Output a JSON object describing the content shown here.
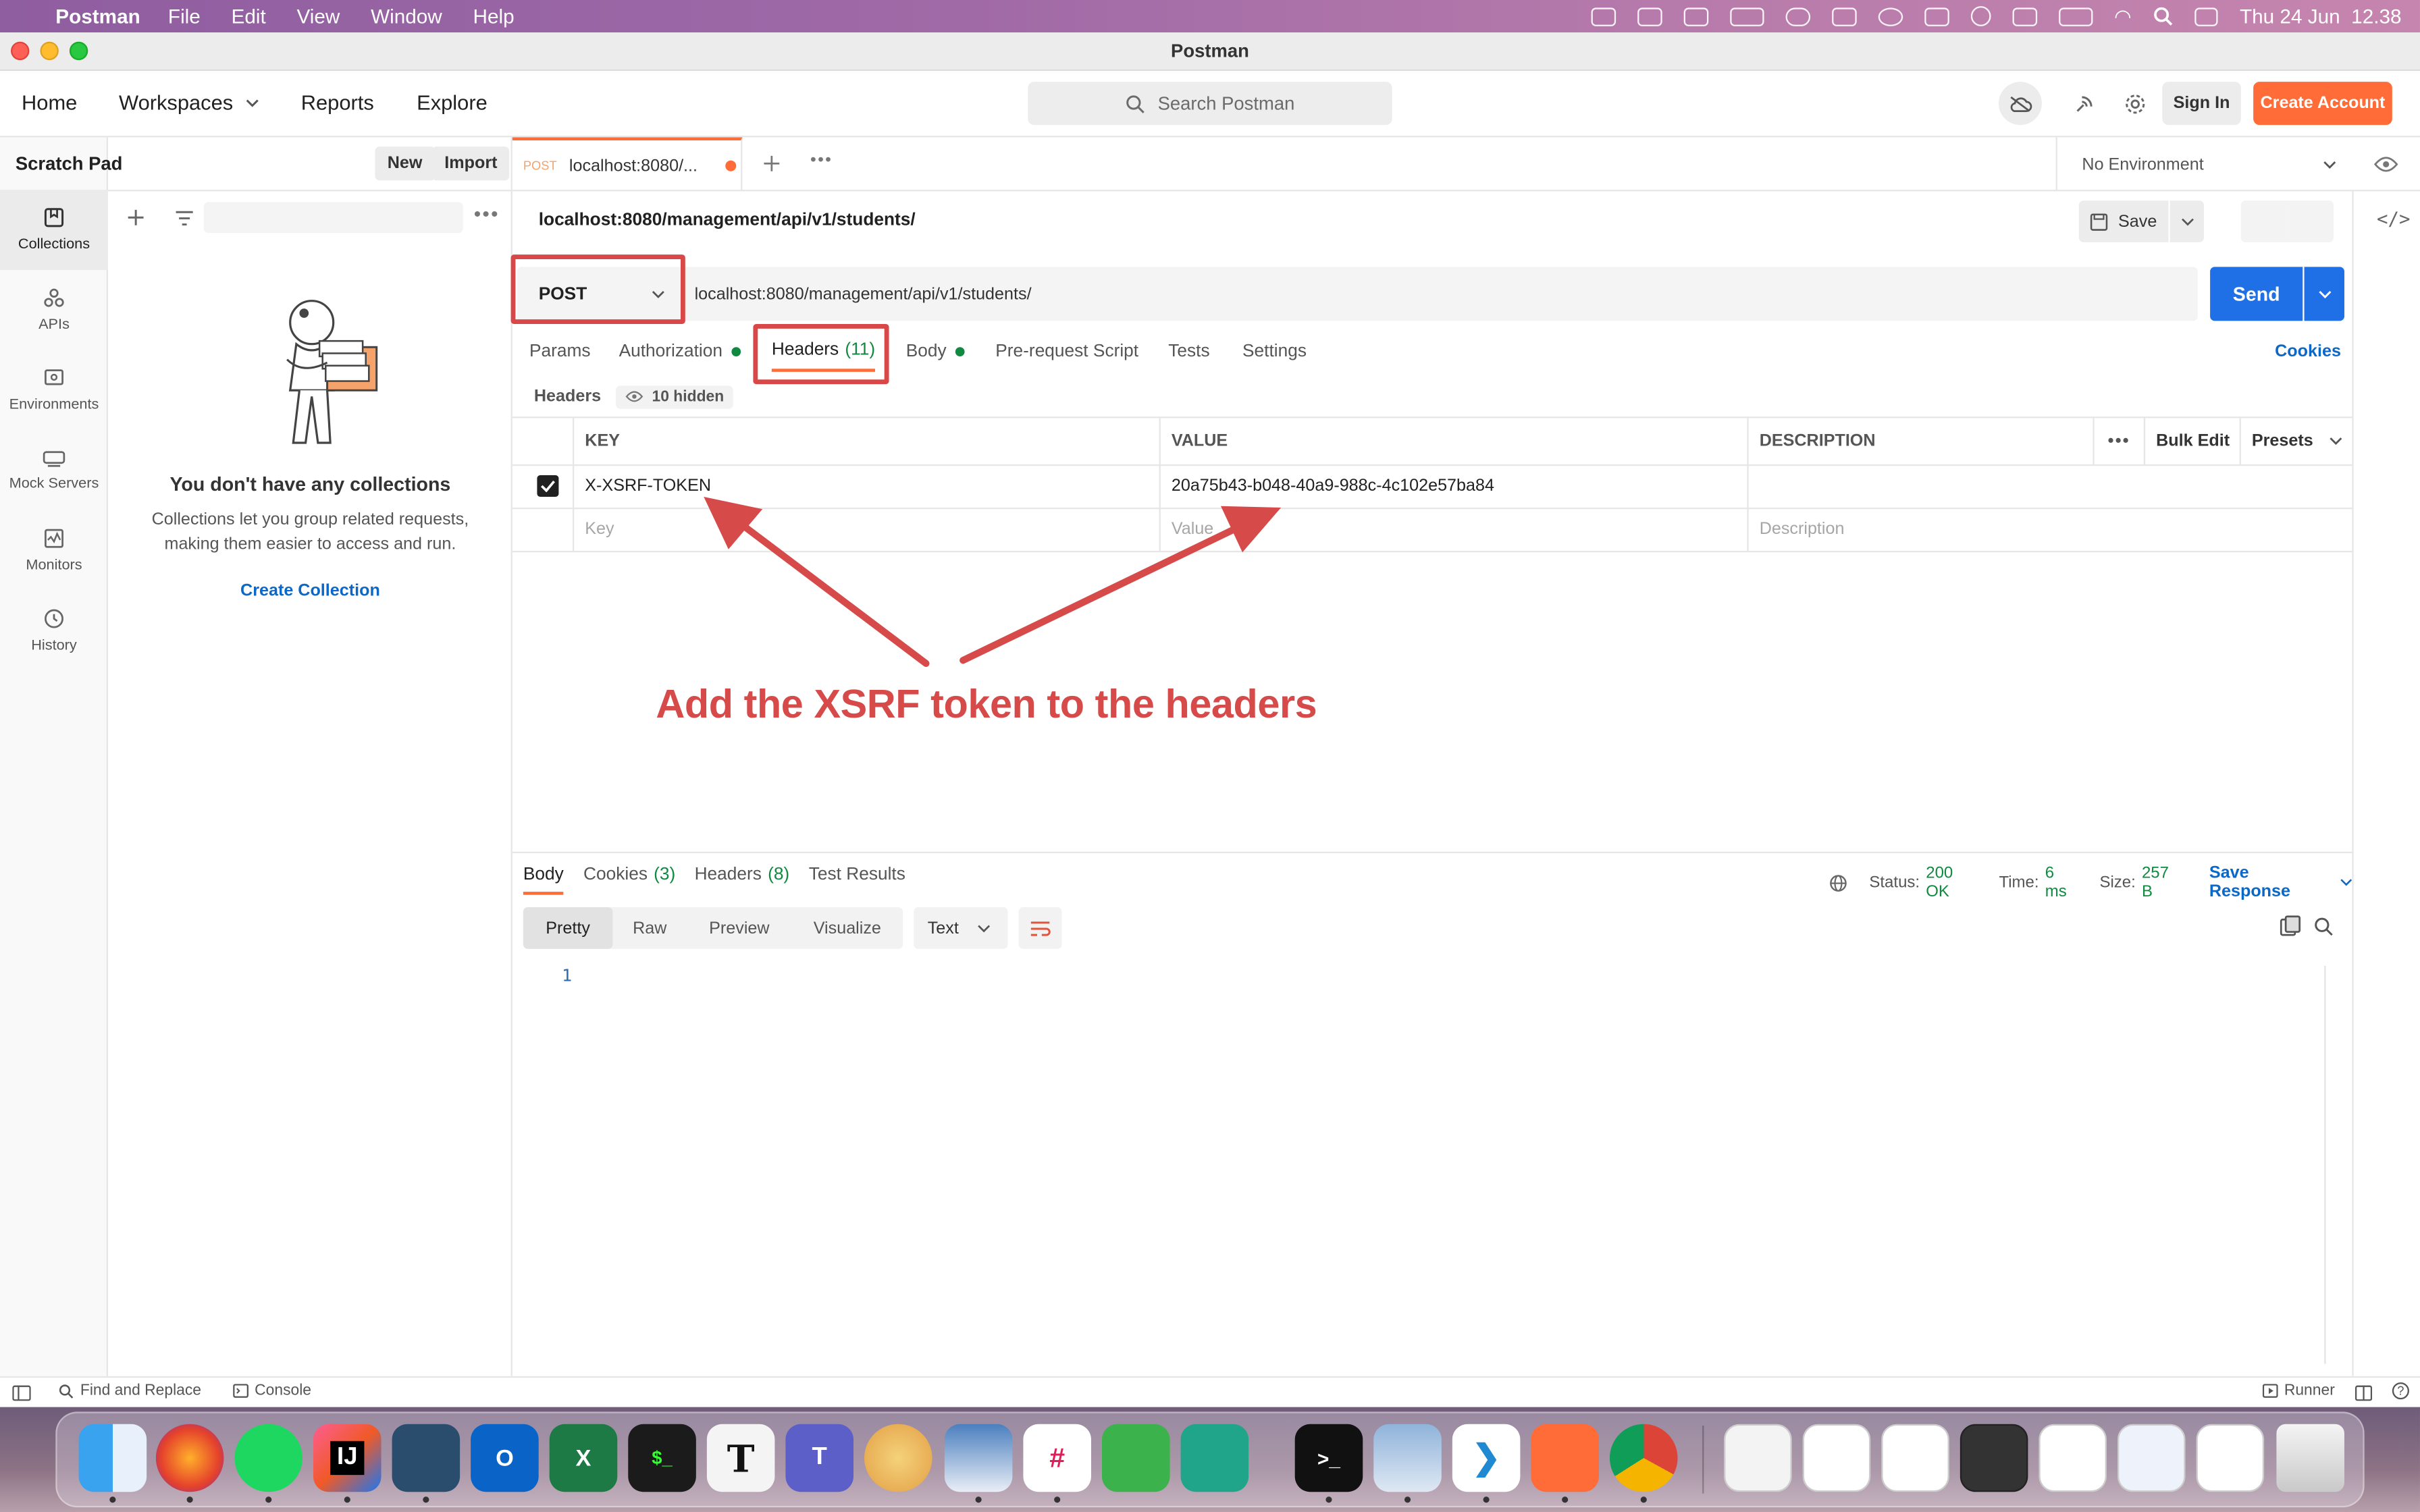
{
  "menubar": {
    "app": "Postman",
    "items": [
      "File",
      "Edit",
      "View",
      "Window",
      "Help"
    ],
    "clock": "Thu 24 Jun  12.38"
  },
  "window": {
    "title": "Postman"
  },
  "header": {
    "nav": [
      "Home",
      "Workspaces",
      "Reports",
      "Explore"
    ],
    "search_placeholder": "Search Postman",
    "sign_in": "Sign In",
    "create_account": "Create Account"
  },
  "rail": {
    "items": [
      "Collections",
      "APIs",
      "Environments",
      "Mock Servers",
      "Monitors",
      "History"
    ]
  },
  "sidebar": {
    "title": "Scratch Pad",
    "new_label": "New",
    "import_label": "Import",
    "empty_title": "You don't have any collections",
    "empty_desc_line1": "Collections let you group related requests,",
    "empty_desc_line2": "making them easier to access and run.",
    "create_collection": "Create Collection"
  },
  "tabbar": {
    "tab_method": "POST",
    "tab_title": "localhost:8080/...",
    "environment": "No Environment"
  },
  "request": {
    "name": "localhost:8080/management/api/v1/students/",
    "save_label": "Save",
    "method": "POST",
    "url": "localhost:8080/management/api/v1/students/",
    "send_label": "Send",
    "tabs": {
      "params": "Params",
      "authorization": "Authorization",
      "headers": "Headers",
      "headers_count": "(11)",
      "body": "Body",
      "prerequest": "Pre-request Script",
      "tests": "Tests",
      "settings": "Settings"
    },
    "cookies": "Cookies",
    "headers_label": "Headers",
    "hidden_label": "10 hidden",
    "table": {
      "col_key": "KEY",
      "col_value": "VALUE",
      "col_description": "DESCRIPTION",
      "bulk_edit": "Bulk Edit",
      "presets": "Presets",
      "row_key": "X-XSRF-TOKEN",
      "row_value": "20a75b43-b048-40a9-988c-4c102e57ba84",
      "placeholder_key": "Key",
      "placeholder_value": "Value",
      "placeholder_description": "Description"
    }
  },
  "annotation": {
    "text": "Add the XSRF token to the headers",
    "color": "#d64a4a"
  },
  "response": {
    "tabs": {
      "body": "Body",
      "cookies": "Cookies",
      "cookies_count": "(3)",
      "headers": "Headers",
      "headers_count": "(8)",
      "test_results": "Test Results"
    },
    "status_label": "Status:",
    "status_value": "200 OK",
    "time_label": "Time:",
    "time_value": "6 ms",
    "size_label": "Size:",
    "size_value": "257 B",
    "save_response": "Save Response",
    "view_modes": [
      "Pretty",
      "Raw",
      "Preview",
      "Visualize"
    ],
    "format": "Text",
    "line_number": "1"
  },
  "statusbar": {
    "find_replace": "Find and Replace",
    "console": "Console",
    "runner": "Runner"
  },
  "colors": {
    "accent": "#ff6c37",
    "send": "#1f6fe6",
    "link": "#0b68c8",
    "success": "#0f8a40"
  }
}
